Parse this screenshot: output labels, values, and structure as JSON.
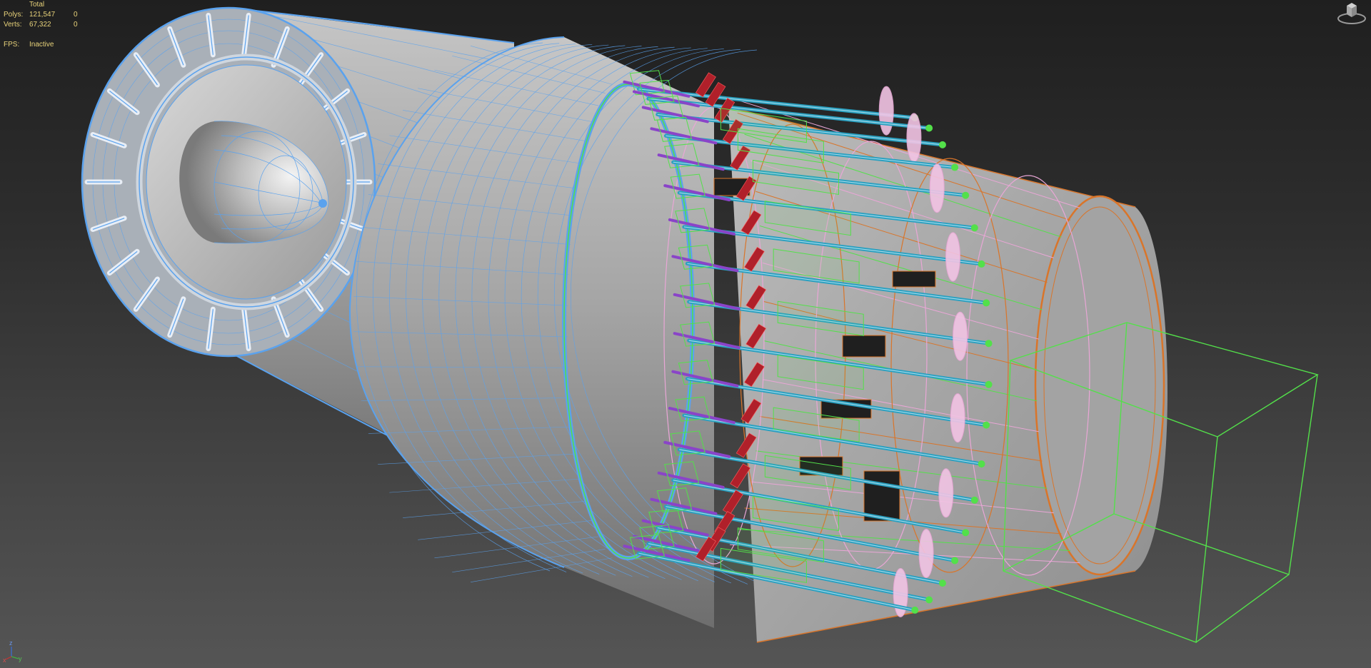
{
  "stats": {
    "header": "Total",
    "polys_label": "Polys:",
    "polys_total": "121,547",
    "polys_selected": "0",
    "verts_label": "Verts:",
    "verts_total": "67,322",
    "verts_selected": "0",
    "fps_label": "FPS:",
    "fps_value": "Inactive"
  },
  "tripod": {
    "z": "z",
    "x": "x",
    "y": "y"
  },
  "icons": {
    "viewcube": "viewcube-icon",
    "tripod": "axis-tripod-icon"
  },
  "colors": {
    "stats_text": "#e8d27a",
    "wire_blue": "#5aa2ee",
    "wire_green": "#53e04a",
    "wire_orange": "#d9752a",
    "wire_pink": "#e9a6d6",
    "wire_purple": "#8a44c8",
    "wire_teal": "#2aa0c0",
    "wire_red": "#b0202a",
    "shade_gray": "#a8a8a8"
  }
}
